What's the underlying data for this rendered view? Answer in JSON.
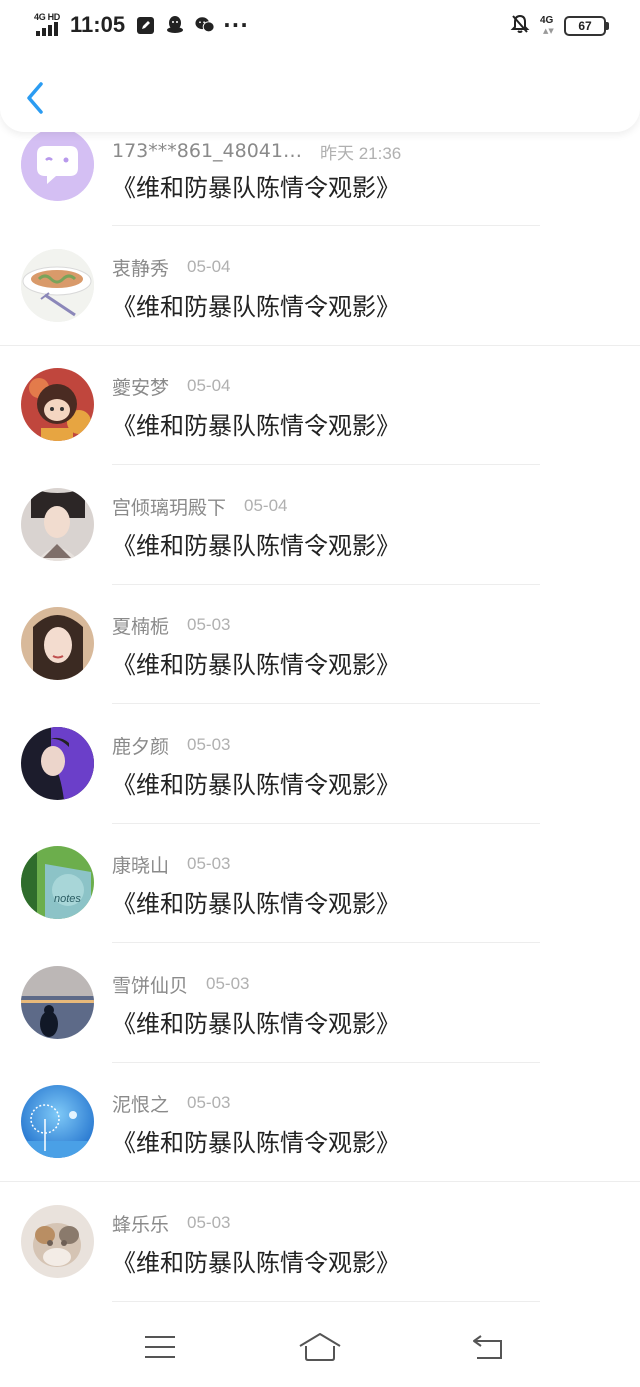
{
  "status_bar": {
    "network_label": "4G HD",
    "time": "11:05",
    "notification_icons": [
      "edit-icon",
      "qq-icon",
      "wechat-icon"
    ],
    "more": "···",
    "mobile_data": "4G",
    "battery": "67"
  },
  "header": {
    "back_icon": "chevron-left-icon",
    "accent_color": "#2b9cf2"
  },
  "messages": [
    {
      "name": "173***861_48041…",
      "date": "昨天 21:36",
      "text": "《维和防暴队陈情令观影》",
      "avatar": "purple-chat-bubble-avatar"
    },
    {
      "name": "衷静秀",
      "date": "05-04",
      "text": "《维和防暴队陈情令观影》",
      "avatar": "pasta-dish-avatar"
    },
    {
      "name": "夔安梦",
      "date": "05-04",
      "text": "《维和防暴队陈情令观影》",
      "avatar": "cartoon-girl-avatar"
    },
    {
      "name": "宫倾璃玥殿下",
      "date": "05-04",
      "text": "《维和防暴队陈情令观影》",
      "avatar": "costume-portrait-avatar"
    },
    {
      "name": "夏楠栀",
      "date": "05-03",
      "text": "《维和防暴队陈情令观影》",
      "avatar": "woman-portrait-avatar"
    },
    {
      "name": "鹿夕颜",
      "date": "05-03",
      "text": "《维和防暴队陈情令观影》",
      "avatar": "man-purple-hoodie-avatar"
    },
    {
      "name": "康晓山",
      "date": "05-03",
      "text": "《维和防暴队陈情令观影》",
      "avatar": "notes-book-avatar"
    },
    {
      "name": "雪饼仙贝",
      "date": "05-03",
      "text": "《维和防暴队陈情令观影》",
      "avatar": "sunset-silhouette-avatar"
    },
    {
      "name": "泥恨之",
      "date": "05-03",
      "text": "《维和防暴队陈情令观影》",
      "avatar": "dandelion-sky-avatar"
    },
    {
      "name": "蜂乐乐",
      "date": "05-03",
      "text": "《维和防暴队陈情令观影》",
      "avatar": "blurry-cat-avatar"
    }
  ],
  "nav_bar": {
    "icons": [
      "menu-icon",
      "home-icon",
      "back-icon"
    ]
  }
}
